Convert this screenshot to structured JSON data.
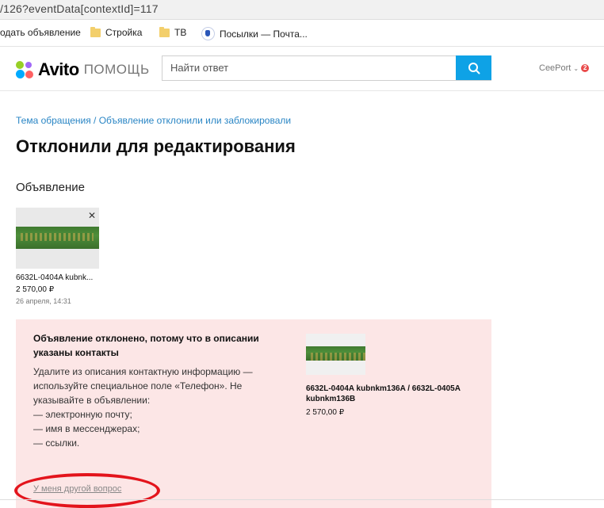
{
  "browser": {
    "url": "/126?eventData[contextId]=117",
    "bookmarks": [
      "одать объявление",
      "Стройка",
      "ТВ",
      "Посылки — Почта..."
    ]
  },
  "header": {
    "brand": "Avito",
    "brand_sub": "ПОМОЩЬ",
    "search_placeholder": "Найти ответ",
    "user_name": "CeePort",
    "user_badge": "2"
  },
  "breadcrumb": "Тема обращения / Объявление отклонили или заблокировали",
  "page_title": "Отклонили для редактирования",
  "section_label": "Объявление",
  "listing": {
    "title": "6632L-0404A kubnk...",
    "price": "2 570,00 ₽",
    "date": "26 апреля, 14:31"
  },
  "notice": {
    "heading": "Объявление отклонено, потому что в описании указаны контакты",
    "body": "Удалите из описания контактную информацию — используйте специальное поле «Телефон». Не указывайте в объявлении:",
    "items": [
      "— электронную почту;",
      "— имя в мессенджерах;",
      "— ссылки."
    ],
    "other_question_link": "У меня другой вопрос",
    "item_title": "6632L-0404A kubnkm136A / 6632L-0405A kubnkm136B",
    "item_price": "2 570,00 ₽"
  },
  "colors": {
    "link": "#2a86c5",
    "search_button": "#0ea2e6",
    "notice_bg": "#fce6e6",
    "highlight_oval": "#e3141c"
  }
}
